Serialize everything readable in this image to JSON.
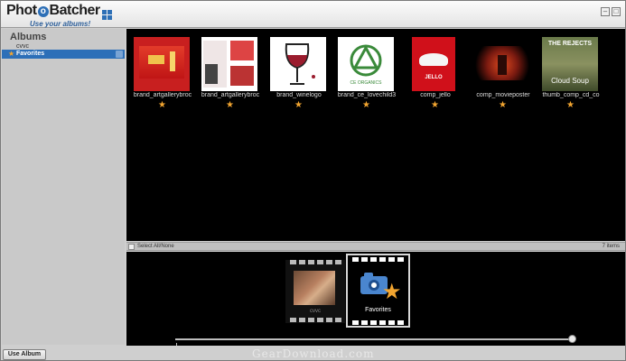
{
  "app": {
    "logo_text_a": "Phot",
    "logo_text_o": "o",
    "logo_text_b": "Batcher",
    "tagline": "Use your albums!",
    "minimize_glyph": "–",
    "maximize_glyph": "□"
  },
  "albums": {
    "heading": "Albums",
    "items": [
      {
        "label": "cvvc",
        "selected": false
      },
      {
        "label": "Favorites",
        "selected": true,
        "icon": "star-icon"
      }
    ]
  },
  "thumbnails": [
    {
      "caption": "brand_artgallerybroc",
      "favorite": true
    },
    {
      "caption": "brand_artgallerybroc",
      "favorite": true
    },
    {
      "caption": "brand_winelogo",
      "favorite": true
    },
    {
      "caption": "brand_ce_lovechild3",
      "favorite": true,
      "image_text": "CE ORGANICS"
    },
    {
      "caption": "comp_jello",
      "favorite": true,
      "image_text": "JELLO"
    },
    {
      "caption": "comp_movieposter",
      "favorite": true
    },
    {
      "caption": "thumb_comp_cd_co",
      "favorite": true,
      "image_text_top": "THE REJECTS",
      "image_text_bottom": "Cloud Soup"
    }
  ],
  "select_bar": {
    "label": "Select All/None",
    "count": "7 items"
  },
  "filmstrip": [
    {
      "caption": "cvvc",
      "selected": false
    },
    {
      "caption": "Favorites",
      "selected": true
    }
  ],
  "slider": {
    "value": 1.0
  },
  "buttons": {
    "use_album": "Use Album"
  },
  "watermark": "GearDownload.com",
  "colors": {
    "accent": "#2c6fb8",
    "star": "#f2a530",
    "content_bg": "#000000"
  }
}
